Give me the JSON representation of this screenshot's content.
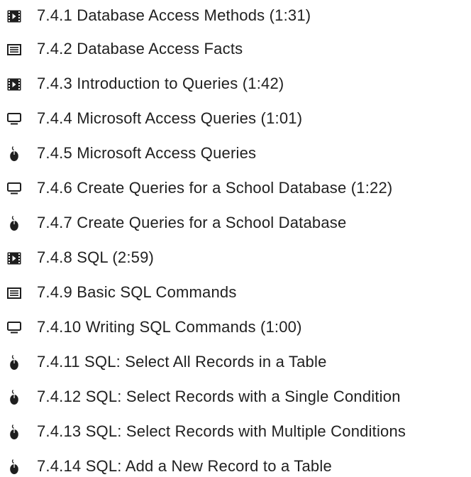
{
  "lessons": [
    {
      "icon": "video-icon",
      "number": "7.4.1",
      "title": "Database Access Methods (1:31)"
    },
    {
      "icon": "document-icon",
      "number": "7.4.2",
      "title": "Database Access Facts"
    },
    {
      "icon": "video-icon",
      "number": "7.4.3",
      "title": "Introduction to Queries (1:42)"
    },
    {
      "icon": "monitor-icon",
      "number": "7.4.4",
      "title": "Microsoft Access Queries (1:01)"
    },
    {
      "icon": "mouse-icon",
      "number": "7.4.5",
      "title": "Microsoft Access Queries"
    },
    {
      "icon": "monitor-icon",
      "number": "7.4.6",
      "title": "Create Queries for a School Database (1:22)"
    },
    {
      "icon": "mouse-icon",
      "number": "7.4.7",
      "title": "Create Queries for a School Database"
    },
    {
      "icon": "video-icon",
      "number": "7.4.8",
      "title": "SQL (2:59)"
    },
    {
      "icon": "document-icon",
      "number": "7.4.9",
      "title": "Basic SQL Commands"
    },
    {
      "icon": "monitor-icon",
      "number": "7.4.10",
      "title": "Writing SQL Commands (1:00)"
    },
    {
      "icon": "mouse-icon",
      "number": "7.4.11",
      "title": "SQL: Select All Records in a Table"
    },
    {
      "icon": "mouse-icon",
      "number": "7.4.12",
      "title": "SQL: Select Records with a Single Condition"
    },
    {
      "icon": "mouse-icon",
      "number": "7.4.13",
      "title": "SQL: Select Records with Multiple Conditions"
    },
    {
      "icon": "mouse-icon",
      "number": "7.4.14",
      "title": "SQL: Add a New Record to a Table"
    }
  ]
}
